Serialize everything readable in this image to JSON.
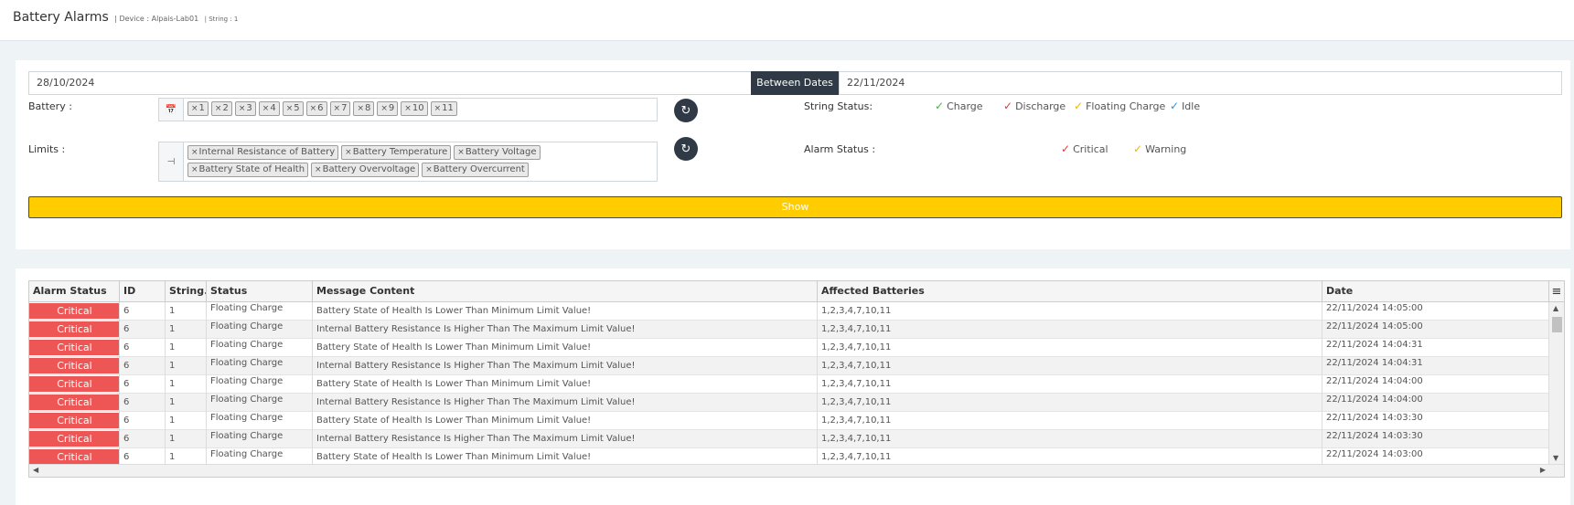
{
  "header": {
    "title": "Battery Alarms",
    "device": "| Device : Alpais-Lab01",
    "string": "| String : 1"
  },
  "filters": {
    "date_from": "28/10/2024",
    "between_label": "Between Dates",
    "date_to": "22/11/2024",
    "battery_label": "Battery :",
    "battery_tags": [
      "1",
      "2",
      "3",
      "4",
      "5",
      "6",
      "7",
      "8",
      "9",
      "10",
      "11"
    ],
    "limits_label": "Limits :",
    "limit_tags": [
      "Internal Resistance of Battery",
      "Battery Temperature",
      "Battery Voltage",
      "Battery State of Health",
      "Battery Overvoltage",
      "Battery Overcurrent"
    ],
    "string_status_label": "String Status:",
    "string_statuses": [
      {
        "label": "Charge",
        "color": "#4caf50"
      },
      {
        "label": "Discharge",
        "color": "#e53935"
      },
      {
        "label": "Floating Charge",
        "color": "#f0b400"
      },
      {
        "label": "Idle",
        "color": "#2196f3"
      }
    ],
    "alarm_status_label": "Alarm Status :",
    "alarm_statuses": [
      {
        "label": "Critical",
        "color": "#e53935"
      },
      {
        "label": "Warning",
        "color": "#f0b400"
      }
    ],
    "show_label": "Show"
  },
  "table": {
    "columns": [
      "Alarm Status",
      "ID",
      "String...",
      "Status",
      "Message Content",
      "Affected Batteries",
      "Date"
    ],
    "rows": [
      {
        "alarm": "Critical",
        "id": "6",
        "string": "1",
        "status": "Floating Charge",
        "message": "Battery State of Health Is Lower Than Minimum Limit Value!",
        "affected": "1,2,3,4,7,10,11",
        "date": "22/11/2024 14:05:00"
      },
      {
        "alarm": "Critical",
        "id": "6",
        "string": "1",
        "status": "Floating Charge",
        "message": "Internal Battery Resistance Is Higher Than The Maximum Limit Value!",
        "affected": "1,2,3,4,7,10,11",
        "date": "22/11/2024 14:05:00"
      },
      {
        "alarm": "Critical",
        "id": "6",
        "string": "1",
        "status": "Floating Charge",
        "message": "Battery State of Health Is Lower Than Minimum Limit Value!",
        "affected": "1,2,3,4,7,10,11",
        "date": "22/11/2024 14:04:31"
      },
      {
        "alarm": "Critical",
        "id": "6",
        "string": "1",
        "status": "Floating Charge",
        "message": "Internal Battery Resistance Is Higher Than The Maximum Limit Value!",
        "affected": "1,2,3,4,7,10,11",
        "date": "22/11/2024 14:04:31"
      },
      {
        "alarm": "Critical",
        "id": "6",
        "string": "1",
        "status": "Floating Charge",
        "message": "Battery State of Health Is Lower Than Minimum Limit Value!",
        "affected": "1,2,3,4,7,10,11",
        "date": "22/11/2024 14:04:00"
      },
      {
        "alarm": "Critical",
        "id": "6",
        "string": "1",
        "status": "Floating Charge",
        "message": "Internal Battery Resistance Is Higher Than The Maximum Limit Value!",
        "affected": "1,2,3,4,7,10,11",
        "date": "22/11/2024 14:04:00"
      },
      {
        "alarm": "Critical",
        "id": "6",
        "string": "1",
        "status": "Floating Charge",
        "message": "Battery State of Health Is Lower Than Minimum Limit Value!",
        "affected": "1,2,3,4,7,10,11",
        "date": "22/11/2024 14:03:30"
      },
      {
        "alarm": "Critical",
        "id": "6",
        "string": "1",
        "status": "Floating Charge",
        "message": "Internal Battery Resistance Is Higher Than The Maximum Limit Value!",
        "affected": "1,2,3,4,7,10,11",
        "date": "22/11/2024 14:03:30"
      },
      {
        "alarm": "Critical",
        "id": "6",
        "string": "1",
        "status": "Floating Charge",
        "message": "Battery State of Health Is Lower Than Minimum Limit Value!",
        "affected": "1,2,3,4,7,10,11",
        "date": "22/11/2024 14:03:00"
      }
    ]
  },
  "colors": {
    "critical": "#ee5655",
    "show_button": "#ffcc00",
    "dark": "#2f3a46"
  }
}
